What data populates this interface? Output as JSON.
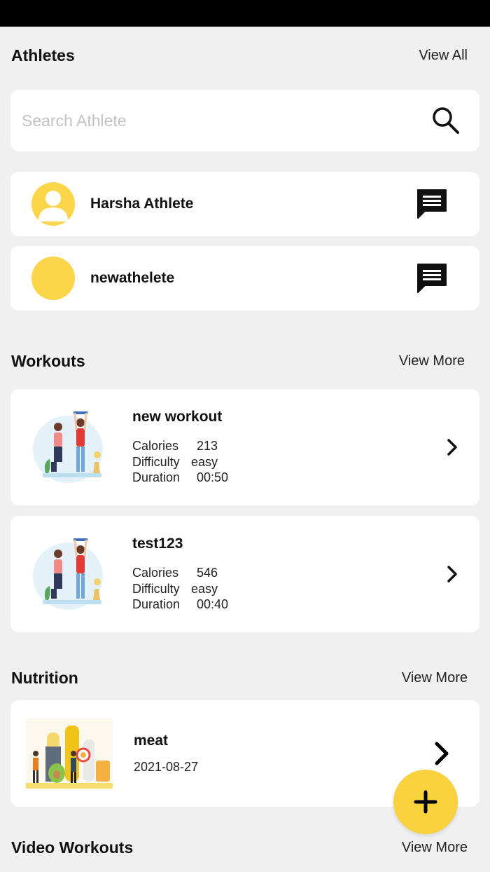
{
  "athletes": {
    "title": "Athletes",
    "view_all": "View All",
    "search_placeholder": "Search Athlete",
    "list": [
      {
        "name": "Harsha Athlete"
      },
      {
        "name": "newathelete"
      }
    ]
  },
  "workouts": {
    "title": "Workouts",
    "view_more": "View More",
    "calories_label": "Calories",
    "difficulty_label": "Difficulty",
    "duration_label": "Duration",
    "items": [
      {
        "title": "new workout",
        "calories": "213",
        "difficulty": "easy",
        "duration": "00:50"
      },
      {
        "title": "test123",
        "calories": "546",
        "difficulty": "easy",
        "duration": "00:40"
      }
    ]
  },
  "nutrition": {
    "title": "Nutrition",
    "view_more": "View More",
    "items": [
      {
        "title": "meat",
        "date": "2021-08-27"
      }
    ]
  },
  "video_workouts": {
    "title": "Video Workouts",
    "view_more": "View More"
  },
  "colors": {
    "accent": "#fad449",
    "background": "#f0f0f0",
    "card": "#ffffff"
  },
  "icons": {
    "search": "search-icon",
    "message": "message-icon",
    "chevron": "chevron-right-icon",
    "add": "plus-icon"
  }
}
